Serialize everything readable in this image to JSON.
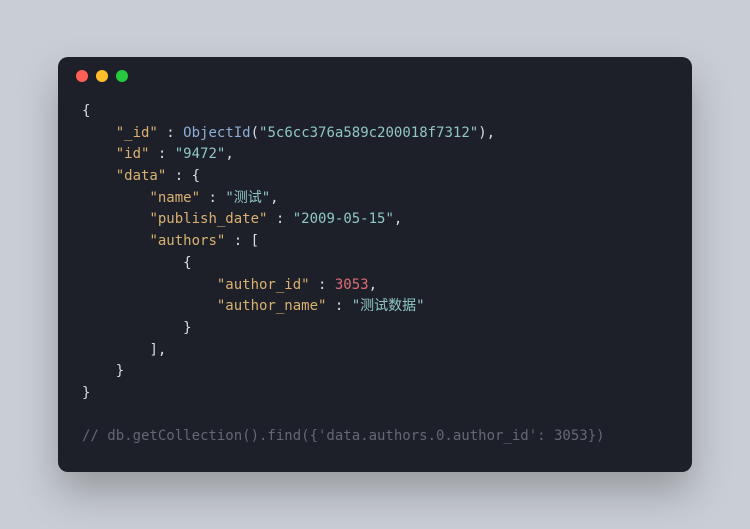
{
  "dots": [
    "red",
    "yellow",
    "green"
  ],
  "code": {
    "l1": "{",
    "l2k": "\"_id\"",
    "l2c": " : ",
    "l2fn": "ObjectId",
    "l2p1": "(",
    "l2s": "\"5c6cc376a589c200018f7312\"",
    "l2p2": "),",
    "l3k": "\"id\"",
    "l3c": " : ",
    "l3s": "\"9472\"",
    "l3p": ",",
    "l4k": "\"data\"",
    "l4c": " : {",
    "l5k": "\"name\"",
    "l5c": " : ",
    "l5s": "\"测试\"",
    "l5p": ",",
    "l6k": "\"publish_date\"",
    "l6c": " : ",
    "l6s": "\"2009-05-15\"",
    "l6p": ",",
    "l7k": "\"authors\"",
    "l7c": " : [",
    "l8": "{",
    "l9k": "\"author_id\"",
    "l9c": " : ",
    "l9n": "3053",
    "l9p": ",",
    "l10k": "\"author_name\"",
    "l10c": " : ",
    "l10s": "\"测试数据\"",
    "l11": "}",
    "l12": "],",
    "l13": "}",
    "l14": "}",
    "comment": "// db.getCollection().find({'data.authors.0.author_id': 3053})"
  }
}
